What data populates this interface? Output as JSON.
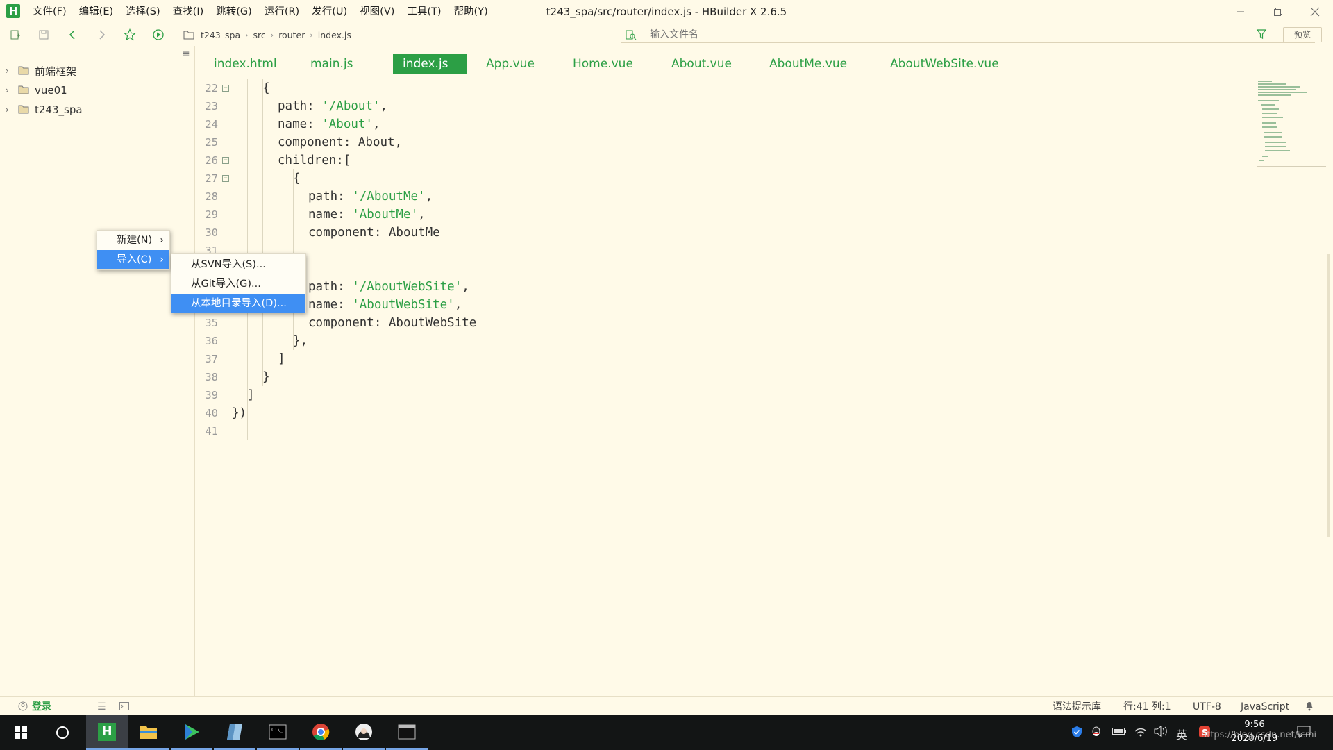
{
  "app": {
    "window_title": "t243_spa/src/router/index.js - HBuilder X 2.6.5",
    "logo_letter": "H",
    "menu": [
      "文件(F)",
      "编辑(E)",
      "选择(S)",
      "查找(I)",
      "跳转(G)",
      "运行(R)",
      "发行(U)",
      "视图(V)",
      "工具(T)",
      "帮助(Y)"
    ]
  },
  "toolbar": {
    "breadcrumb": [
      "t243_spa",
      "src",
      "router",
      "index.js"
    ],
    "search_placeholder": "输入文件名",
    "preview_label": "预览"
  },
  "sidebar": {
    "items": [
      {
        "label": "前端框架"
      },
      {
        "label": "vue01"
      },
      {
        "label": "t243_spa"
      }
    ]
  },
  "tabs": [
    {
      "label": "index.html"
    },
    {
      "label": "main.js"
    },
    {
      "label": "index.js",
      "active": true
    },
    {
      "label": "App.vue"
    },
    {
      "label": "Home.vue"
    },
    {
      "label": "About.vue"
    },
    {
      "label": "AboutMe.vue"
    },
    {
      "label": "AboutWebSite.vue"
    }
  ],
  "editor": {
    "line_numbers": [
      "22",
      "23",
      "24",
      "25",
      "26",
      "27",
      "28",
      "29",
      "30",
      "31",
      "32",
      "33",
      "34",
      "35",
      "36",
      "37",
      "38",
      "39",
      "40",
      "41"
    ],
    "code": {
      "l22": "{",
      "l23_key": "path: ",
      "l23_str": "'/About'",
      "l23_end": ",",
      "l24_key": "name: ",
      "l24_str": "'About'",
      "l24_end": ",",
      "l25": "component: About,",
      "l26": "children:[",
      "l27": "{",
      "l28_key": "path: ",
      "l28_str": "'/AboutMe'",
      "l28_end": ",",
      "l29_key": "name: ",
      "l29_str": "'AboutMe'",
      "l29_end": ",",
      "l30": "component: AboutMe",
      "l33_key": "path: ",
      "l33_str": "'/AboutWebSite'",
      "l33_end": ",",
      "l34_key": "name: ",
      "l34_str": "'AboutWebSite'",
      "l34_end": ",",
      "l35": "component: AboutWebSite",
      "l36": "},",
      "l37": "]",
      "l38": "}",
      "l39": "]",
      "l40": "})"
    }
  },
  "context_menu": {
    "items": [
      {
        "label": "新建(N)"
      },
      {
        "label": "导入(C)"
      }
    ],
    "submenu": [
      {
        "label": "从SVN导入(S)..."
      },
      {
        "label": "从Git导入(G)..."
      },
      {
        "label": "从本地目录导入(D)..."
      }
    ]
  },
  "statusbar": {
    "login": "登录",
    "syntax_hint": "语法提示库",
    "cursor": "行:41  列:1",
    "encoding": "UTF-8",
    "language": "JavaScript"
  },
  "taskbar": {
    "time": "9:56",
    "date": "2020/6/19",
    "ime": "英",
    "watermark": "https://blog.csdn.net/icmi"
  },
  "colors": {
    "background": "#fffae8",
    "accent_green": "#2c9f45",
    "menu_highlight": "#3f8ff3",
    "taskbar": "#131515"
  }
}
